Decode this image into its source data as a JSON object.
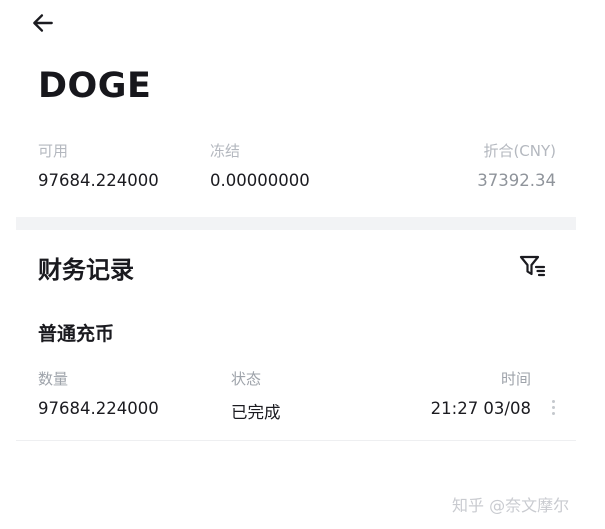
{
  "header": {
    "coin": "DOGE"
  },
  "balance": {
    "available_label": "可用",
    "available_value": "97684.224000",
    "frozen_label": "冻结",
    "frozen_value": "0.00000000",
    "converted_label": "折合(CNY)",
    "converted_value": "37392.34"
  },
  "records": {
    "title": "财务记录",
    "type": "普通充币",
    "columns": {
      "amount": "数量",
      "status": "状态",
      "time": "时间"
    },
    "rows": [
      {
        "amount": "97684.224000",
        "status": "已完成",
        "time": "21:27 03/08"
      }
    ]
  },
  "watermark": "知乎 @奈文摩尔",
  "icons": {
    "back": "arrow-left-icon",
    "filter": "filter-icon",
    "more": "more-vertical-icon"
  }
}
